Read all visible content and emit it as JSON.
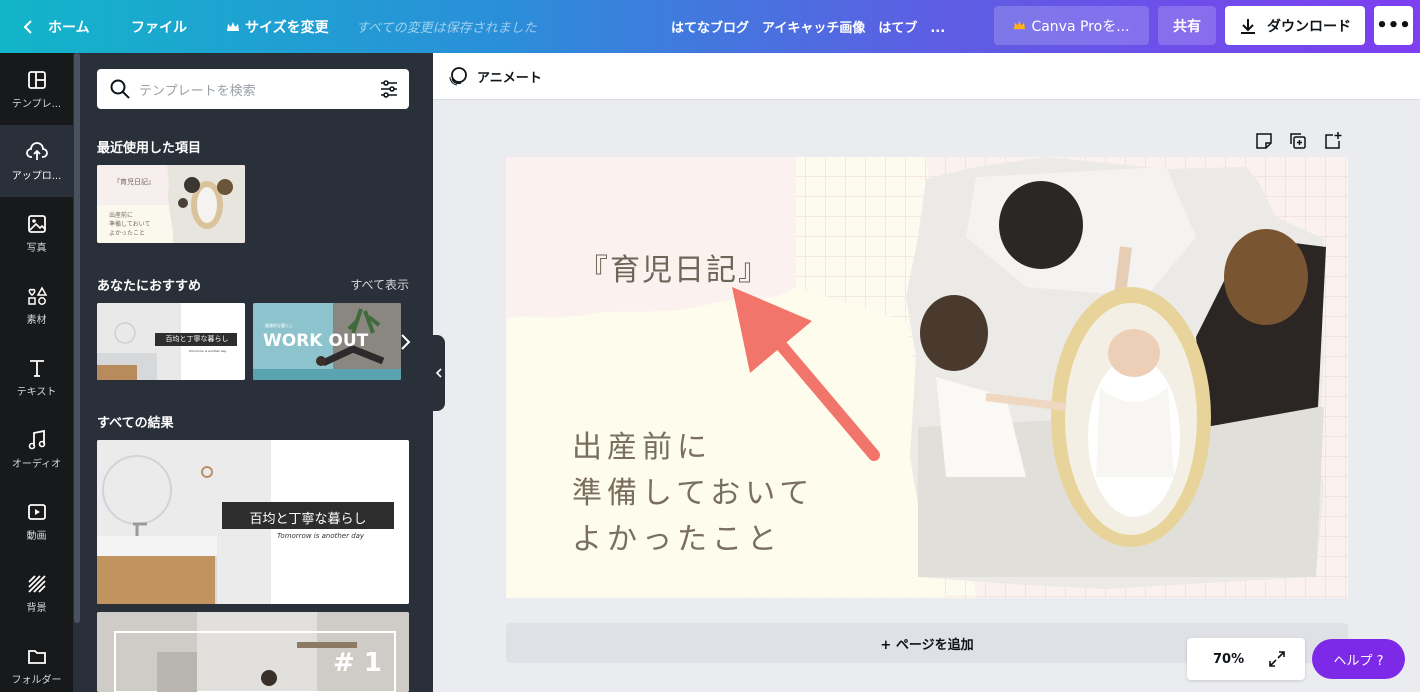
{
  "topbar": {
    "home": "ホーム",
    "file": "ファイル",
    "resize": "サイズを変更",
    "saved_status": "すべての変更は保存されました",
    "doc_title": "はてなブログ　アイキャッチ画像　はてブ　...",
    "pro_button": "Canva Proを...",
    "share_button": "共有",
    "download_button": "ダウンロード",
    "more_button": "•••"
  },
  "rail": {
    "items": [
      {
        "label": "テンプレ...",
        "icon": "layout-icon"
      },
      {
        "label": "アップロ...",
        "icon": "cloud-upload-icon"
      },
      {
        "label": "写真",
        "icon": "image-icon"
      },
      {
        "label": "素材",
        "icon": "shapes-icon"
      },
      {
        "label": "テキスト",
        "icon": "text-icon"
      },
      {
        "label": "オーディオ",
        "icon": "music-icon"
      },
      {
        "label": "動画",
        "icon": "video-icon"
      },
      {
        "label": "背景",
        "icon": "pattern-icon"
      },
      {
        "label": "フォルダー",
        "icon": "folder-icon"
      }
    ]
  },
  "panel": {
    "search_placeholder": "テンプレートを検索",
    "recent_title": "最近使用した項目",
    "recommend_title": "あなたにおすすめ",
    "see_all": "すべて表示",
    "results_title": "すべての結果",
    "recent_thumb": {
      "title": "『育児日記』",
      "lines": [
        "出産前に",
        "準備しておいて",
        "よかったこと"
      ]
    },
    "rec_thumb_1": {
      "caption": "百均と丁寧な暮らし",
      "script": "Tomorrow is another day"
    },
    "rec_thumb_2": {
      "small": "健康的な暮らし",
      "title": "WORK OUT"
    },
    "result_thumb_1": {
      "caption": "百均と丁寧な暮らし",
      "script": "Tomorrow is another day"
    },
    "result_thumb_2": {
      "number": "# 1"
    }
  },
  "editor": {
    "animate_label": "アニメート",
    "design_title": "『育児日記』",
    "design_lines": [
      "出産前に",
      "準備しておいて",
      "よかったこと"
    ],
    "add_page": "+ ページを追加",
    "zoom_level": "70%",
    "help_label": "ヘルプ ?"
  },
  "colors": {
    "rail_bg": "#18191b",
    "panel_bg": "#293039",
    "help_purple": "#7d2ae8",
    "arrow": "#f2756b"
  }
}
